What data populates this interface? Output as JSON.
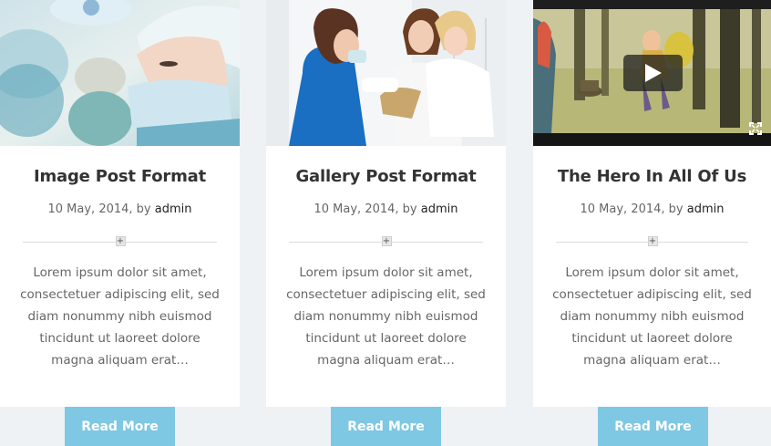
{
  "posts": [
    {
      "title": "Image Post Format",
      "date": "10 May, 2014, by ",
      "author": "admin",
      "excerpt": "Lorem ipsum dolor sit amet, consectetuer adipiscing elit, sed diam nonummy nibh euismod tincidunt ut laoreet dolore magna aliquam erat…",
      "button": "Read More",
      "media": "photo-surgeon"
    },
    {
      "title": "Gallery Post Format",
      "date": "10 May, 2014, by ",
      "author": "admin",
      "excerpt": "Lorem ipsum dolor sit amet, consectetuer adipiscing elit, sed diam nonummy nibh euismod tincidunt ut laoreet dolore magna aliquam erat…",
      "button": "Read More",
      "media": "photo-nurse-child"
    },
    {
      "title": "The Hero In All Of Us",
      "date": "10 May, 2014, by ",
      "author": "admin",
      "excerpt": "Lorem ipsum dolor sit amet, consectetuer adipiscing elit, sed diam nonummy nibh euismod tincidunt ut laoreet dolore magna aliquam erat…",
      "button": "Read More",
      "media": "video-animated-forest"
    }
  ],
  "divider_symbol": "+",
  "colors": {
    "button": "#7ec8e3",
    "background": "#eef2f5",
    "card": "#ffffff"
  },
  "icons": [
    "play-icon",
    "fullscreen-icon"
  ]
}
